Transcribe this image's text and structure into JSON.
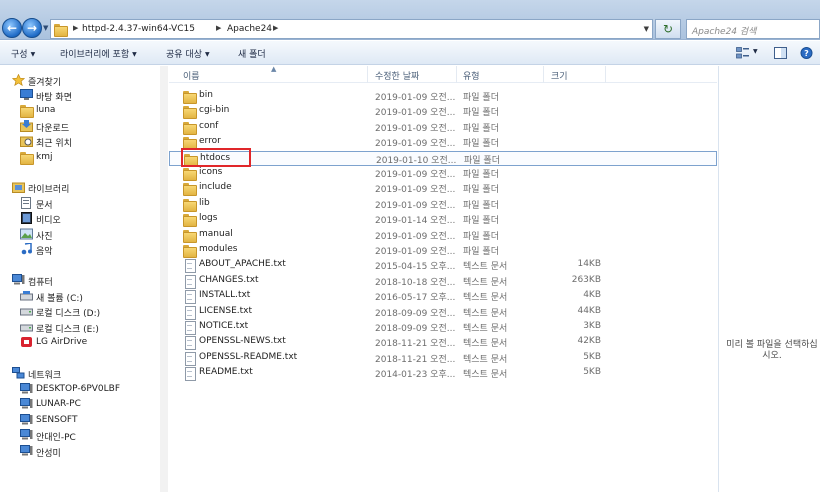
{
  "address": {
    "crumbs": [
      "httpd-2.4.37-win64-VC15",
      "Apache24"
    ],
    "search_placeholder": "Apache24 검색"
  },
  "toolbar": {
    "organize": "구성",
    "include_library": "라이브러리에 포함",
    "share": "공유 대상",
    "new_folder": "새 폴더"
  },
  "sidebar": {
    "favorites": {
      "label": "즐겨찾기",
      "items": [
        {
          "label": "바탕 화면",
          "icon": "desktop-icon"
        },
        {
          "label": "luna",
          "icon": "folder-icon"
        },
        {
          "label": "다운로드",
          "icon": "downloads-icon"
        },
        {
          "label": "최근 위치",
          "icon": "recent-places-icon"
        },
        {
          "label": "kmj",
          "icon": "folder-icon"
        }
      ]
    },
    "libraries": {
      "label": "라이브러리",
      "items": [
        {
          "label": "문서",
          "icon": "documents-icon"
        },
        {
          "label": "비디오",
          "icon": "videos-icon"
        },
        {
          "label": "사진",
          "icon": "pictures-icon"
        },
        {
          "label": "음악",
          "icon": "music-icon"
        }
      ]
    },
    "computer": {
      "label": "컴퓨터",
      "items": [
        {
          "label": "새 볼륨 (C:)",
          "icon": "drive-icon"
        },
        {
          "label": "로컬 디스크 (D:)",
          "icon": "drive-icon"
        },
        {
          "label": "로컬 디스크 (E:)",
          "icon": "drive-icon"
        },
        {
          "label": "LG AirDrive",
          "icon": "airdrive-icon"
        }
      ]
    },
    "network": {
      "label": "네트워크",
      "items": [
        {
          "label": "DESKTOP-6PV0LBF",
          "icon": "network-computer-icon"
        },
        {
          "label": "LUNAR-PC",
          "icon": "network-computer-icon"
        },
        {
          "label": "SENSOFT",
          "icon": "network-computer-icon"
        },
        {
          "label": "안대인-PC",
          "icon": "network-computer-icon"
        },
        {
          "label": "안성미",
          "icon": "network-computer-icon"
        }
      ]
    }
  },
  "columns": {
    "name": "이름",
    "modified": "수정한 날짜",
    "type": "유형",
    "size": "크기"
  },
  "files": [
    {
      "name": "bin",
      "modified": "2019-01-09 오전...",
      "type": "파일 폴더",
      "size": "",
      "kind": "folder"
    },
    {
      "name": "cgi-bin",
      "modified": "2019-01-09 오전...",
      "type": "파일 폴더",
      "size": "",
      "kind": "folder"
    },
    {
      "name": "conf",
      "modified": "2019-01-09 오전...",
      "type": "파일 폴더",
      "size": "",
      "kind": "folder"
    },
    {
      "name": "error",
      "modified": "2019-01-09 오전...",
      "type": "파일 폴더",
      "size": "",
      "kind": "folder"
    },
    {
      "name": "htdocs",
      "modified": "2019-01-10 오전...",
      "type": "파일 폴더",
      "size": "",
      "kind": "folder"
    },
    {
      "name": "icons",
      "modified": "2019-01-09 오전...",
      "type": "파일 폴더",
      "size": "",
      "kind": "folder"
    },
    {
      "name": "include",
      "modified": "2019-01-09 오전...",
      "type": "파일 폴더",
      "size": "",
      "kind": "folder"
    },
    {
      "name": "lib",
      "modified": "2019-01-09 오전...",
      "type": "파일 폴더",
      "size": "",
      "kind": "folder"
    },
    {
      "name": "logs",
      "modified": "2019-01-14 오전...",
      "type": "파일 폴더",
      "size": "",
      "kind": "folder"
    },
    {
      "name": "manual",
      "modified": "2019-01-09 오전...",
      "type": "파일 폴더",
      "size": "",
      "kind": "folder"
    },
    {
      "name": "modules",
      "modified": "2019-01-09 오전...",
      "type": "파일 폴더",
      "size": "",
      "kind": "folder"
    },
    {
      "name": "ABOUT_APACHE.txt",
      "modified": "2015-04-15 오후...",
      "type": "텍스트 문서",
      "size": "14KB",
      "kind": "doc"
    },
    {
      "name": "CHANGES.txt",
      "modified": "2018-10-18 오전...",
      "type": "텍스트 문서",
      "size": "263KB",
      "kind": "doc"
    },
    {
      "name": "INSTALL.txt",
      "modified": "2016-05-17 오후...",
      "type": "텍스트 문서",
      "size": "4KB",
      "kind": "doc"
    },
    {
      "name": "LICENSE.txt",
      "modified": "2018-09-09 오전...",
      "type": "텍스트 문서",
      "size": "44KB",
      "kind": "doc"
    },
    {
      "name": "NOTICE.txt",
      "modified": "2018-09-09 오전...",
      "type": "텍스트 문서",
      "size": "3KB",
      "kind": "doc"
    },
    {
      "name": "OPENSSL-NEWS.txt",
      "modified": "2018-11-21 오전...",
      "type": "텍스트 문서",
      "size": "42KB",
      "kind": "doc"
    },
    {
      "name": "OPENSSL-README.txt",
      "modified": "2018-11-21 오전...",
      "type": "텍스트 문서",
      "size": "5KB",
      "kind": "doc"
    },
    {
      "name": "README.txt",
      "modified": "2014-01-23 오후...",
      "type": "텍스트 문서",
      "size": "5KB",
      "kind": "doc"
    }
  ],
  "preview": {
    "message": "미리 볼 파일을 선택하십시오."
  },
  "colors": {
    "highlight_box": "#e0262a",
    "selection_border": "#7da2ce"
  }
}
